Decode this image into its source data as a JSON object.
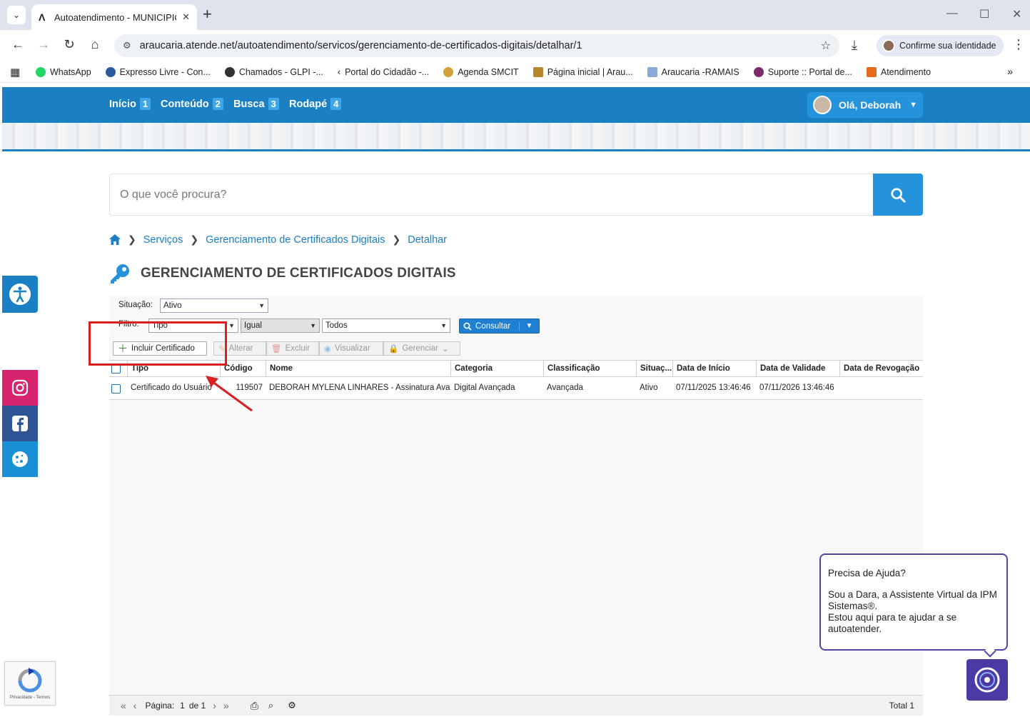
{
  "browser": {
    "tab_title": "Autoatendimento - MUNICIPIO",
    "url": "araucaria.atende.net/autoatendimento/servicos/gerenciamento-de-certificados-digitais/detalhar/1",
    "identity_label": "Confirme sua identidade",
    "bookmarks": [
      "WhatsApp",
      "Expresso Livre - Con...",
      "Chamados - GLPI -...",
      "Portal do Cidadão -...",
      "Agenda SMCIT",
      "Página inicial | Arau...",
      "Araucaria -RAMAIS",
      "Suporte :: Portal de...",
      "Atendimento"
    ]
  },
  "nav": {
    "links": [
      {
        "label": "Início",
        "num": "1"
      },
      {
        "label": "Conteúdo",
        "num": "2"
      },
      {
        "label": "Busca",
        "num": "3"
      },
      {
        "label": "Rodapé",
        "num": "4"
      }
    ],
    "user_greeting": "Olá, Deborah"
  },
  "search": {
    "placeholder": "O que você procura?"
  },
  "breadcrumb": [
    "Serviços",
    "Gerenciamento de Certificados Digitais",
    "Detalhar"
  ],
  "page_title": "GERENCIAMENTO DE CERTIFICADOS DIGITAIS",
  "filters": {
    "situacao_label": "Situação:",
    "situacao_value": "Ativo",
    "filtro_label": "Filtro:",
    "filtro_field": "Tipo",
    "filtro_operator": "Igual",
    "filtro_value": "Todos",
    "consultar_label": "Consultar"
  },
  "toolbar": {
    "incluir": "Incluir Certificado",
    "alterar": "Alterar",
    "excluir": "Excluir",
    "visualizar": "Visualizar",
    "gerenciar": "Gerenciar"
  },
  "table": {
    "columns": [
      "Tipo",
      "Código",
      "Nome",
      "Categoria",
      "Classificação",
      "Situaç...",
      "Data de Início",
      "Data de Validade",
      "Data de Revogação"
    ],
    "rows": [
      [
        "Certificado do Usuário",
        "119507",
        "DEBORAH MYLENA LINHARES - Assinatura Ava...",
        "Digital Avançada",
        "Avançada",
        "Ativo",
        "07/11/2025 13:46:46",
        "07/11/2026 13:46:46",
        ""
      ]
    ]
  },
  "pager": {
    "label": "Página:",
    "page": "1",
    "of": "de 1",
    "total": "Total 1"
  },
  "chat": {
    "question": "Precisa de Ajuda?",
    "intro": "Sou a Dara, a Assistente Virtual da IPM Sistemas®.",
    "help": "Estou aqui para te ajudar a se autoatender."
  },
  "recaptcha": {
    "text": "Privacidade - Termos"
  },
  "colors": {
    "primary": "#1a80c3",
    "accent": "#2493db",
    "annotation": "#d92020",
    "chat": "#4b3aa6"
  }
}
